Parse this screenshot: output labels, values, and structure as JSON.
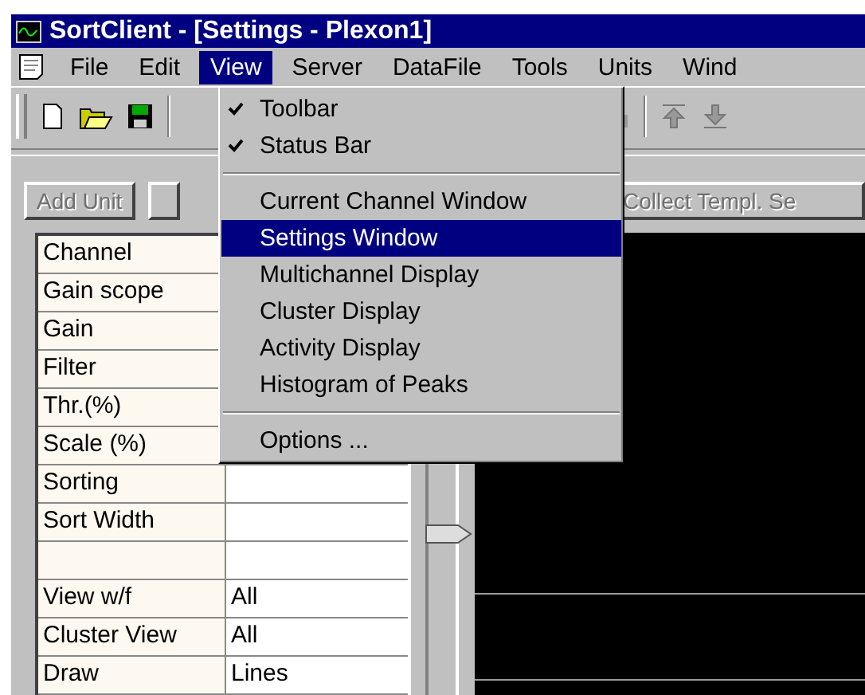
{
  "window": {
    "title": "SortClient - [Settings - Plexon1]"
  },
  "menu_bar": [
    {
      "label": "File",
      "selected": false
    },
    {
      "label": "Edit",
      "selected": false
    },
    {
      "label": "View",
      "selected": true
    },
    {
      "label": "Server",
      "selected": false
    },
    {
      "label": "DataFile",
      "selected": false
    },
    {
      "label": "Tools",
      "selected": false
    },
    {
      "label": "Units",
      "selected": false
    },
    {
      "label": "Wind",
      "selected": false
    }
  ],
  "view_menu": [
    {
      "kind": "item",
      "label": "Toolbar",
      "checked": true,
      "selected": false
    },
    {
      "kind": "item",
      "label": "Status Bar",
      "checked": true,
      "selected": false
    },
    {
      "kind": "separator"
    },
    {
      "kind": "item",
      "label": "Current Channel Window",
      "checked": false,
      "selected": false
    },
    {
      "kind": "item",
      "label": "Settings Window",
      "checked": false,
      "selected": true
    },
    {
      "kind": "item",
      "label": "Multichannel Display",
      "checked": false,
      "selected": false
    },
    {
      "kind": "item",
      "label": "Cluster Display",
      "checked": false,
      "selected": false
    },
    {
      "kind": "item",
      "label": "Activity Display",
      "checked": false,
      "selected": false
    },
    {
      "kind": "item",
      "label": "Histogram of Peaks",
      "checked": false,
      "selected": false
    },
    {
      "kind": "separator"
    },
    {
      "kind": "item",
      "label": "Options ...",
      "checked": false,
      "selected": false
    }
  ],
  "buttons": [
    {
      "label": "Add Unit",
      "disabled": true
    },
    {
      "label": "Collect Templ. Se",
      "disabled": true
    }
  ],
  "settings_table": [
    {
      "kind": "name_only",
      "name": "Channel"
    },
    {
      "kind": "name_only",
      "name": "Gain scope"
    },
    {
      "kind": "name_only",
      "name": "Gain"
    },
    {
      "kind": "name_only",
      "name": "Filter"
    },
    {
      "kind": "name_only",
      "name": "Thr.(%)"
    },
    {
      "kind": "name_only",
      "name": "Scale (%)"
    },
    {
      "kind": "setting",
      "name": "Sorting"
    },
    {
      "kind": "setting",
      "name": "Sort Width"
    },
    {
      "kind": "blank"
    },
    {
      "kind": "setting",
      "name": "View w/f",
      "value": "All"
    },
    {
      "kind": "setting",
      "name": "Cluster View",
      "value": "All"
    },
    {
      "kind": "setting",
      "name": "Draw",
      "value": "Lines"
    }
  ]
}
